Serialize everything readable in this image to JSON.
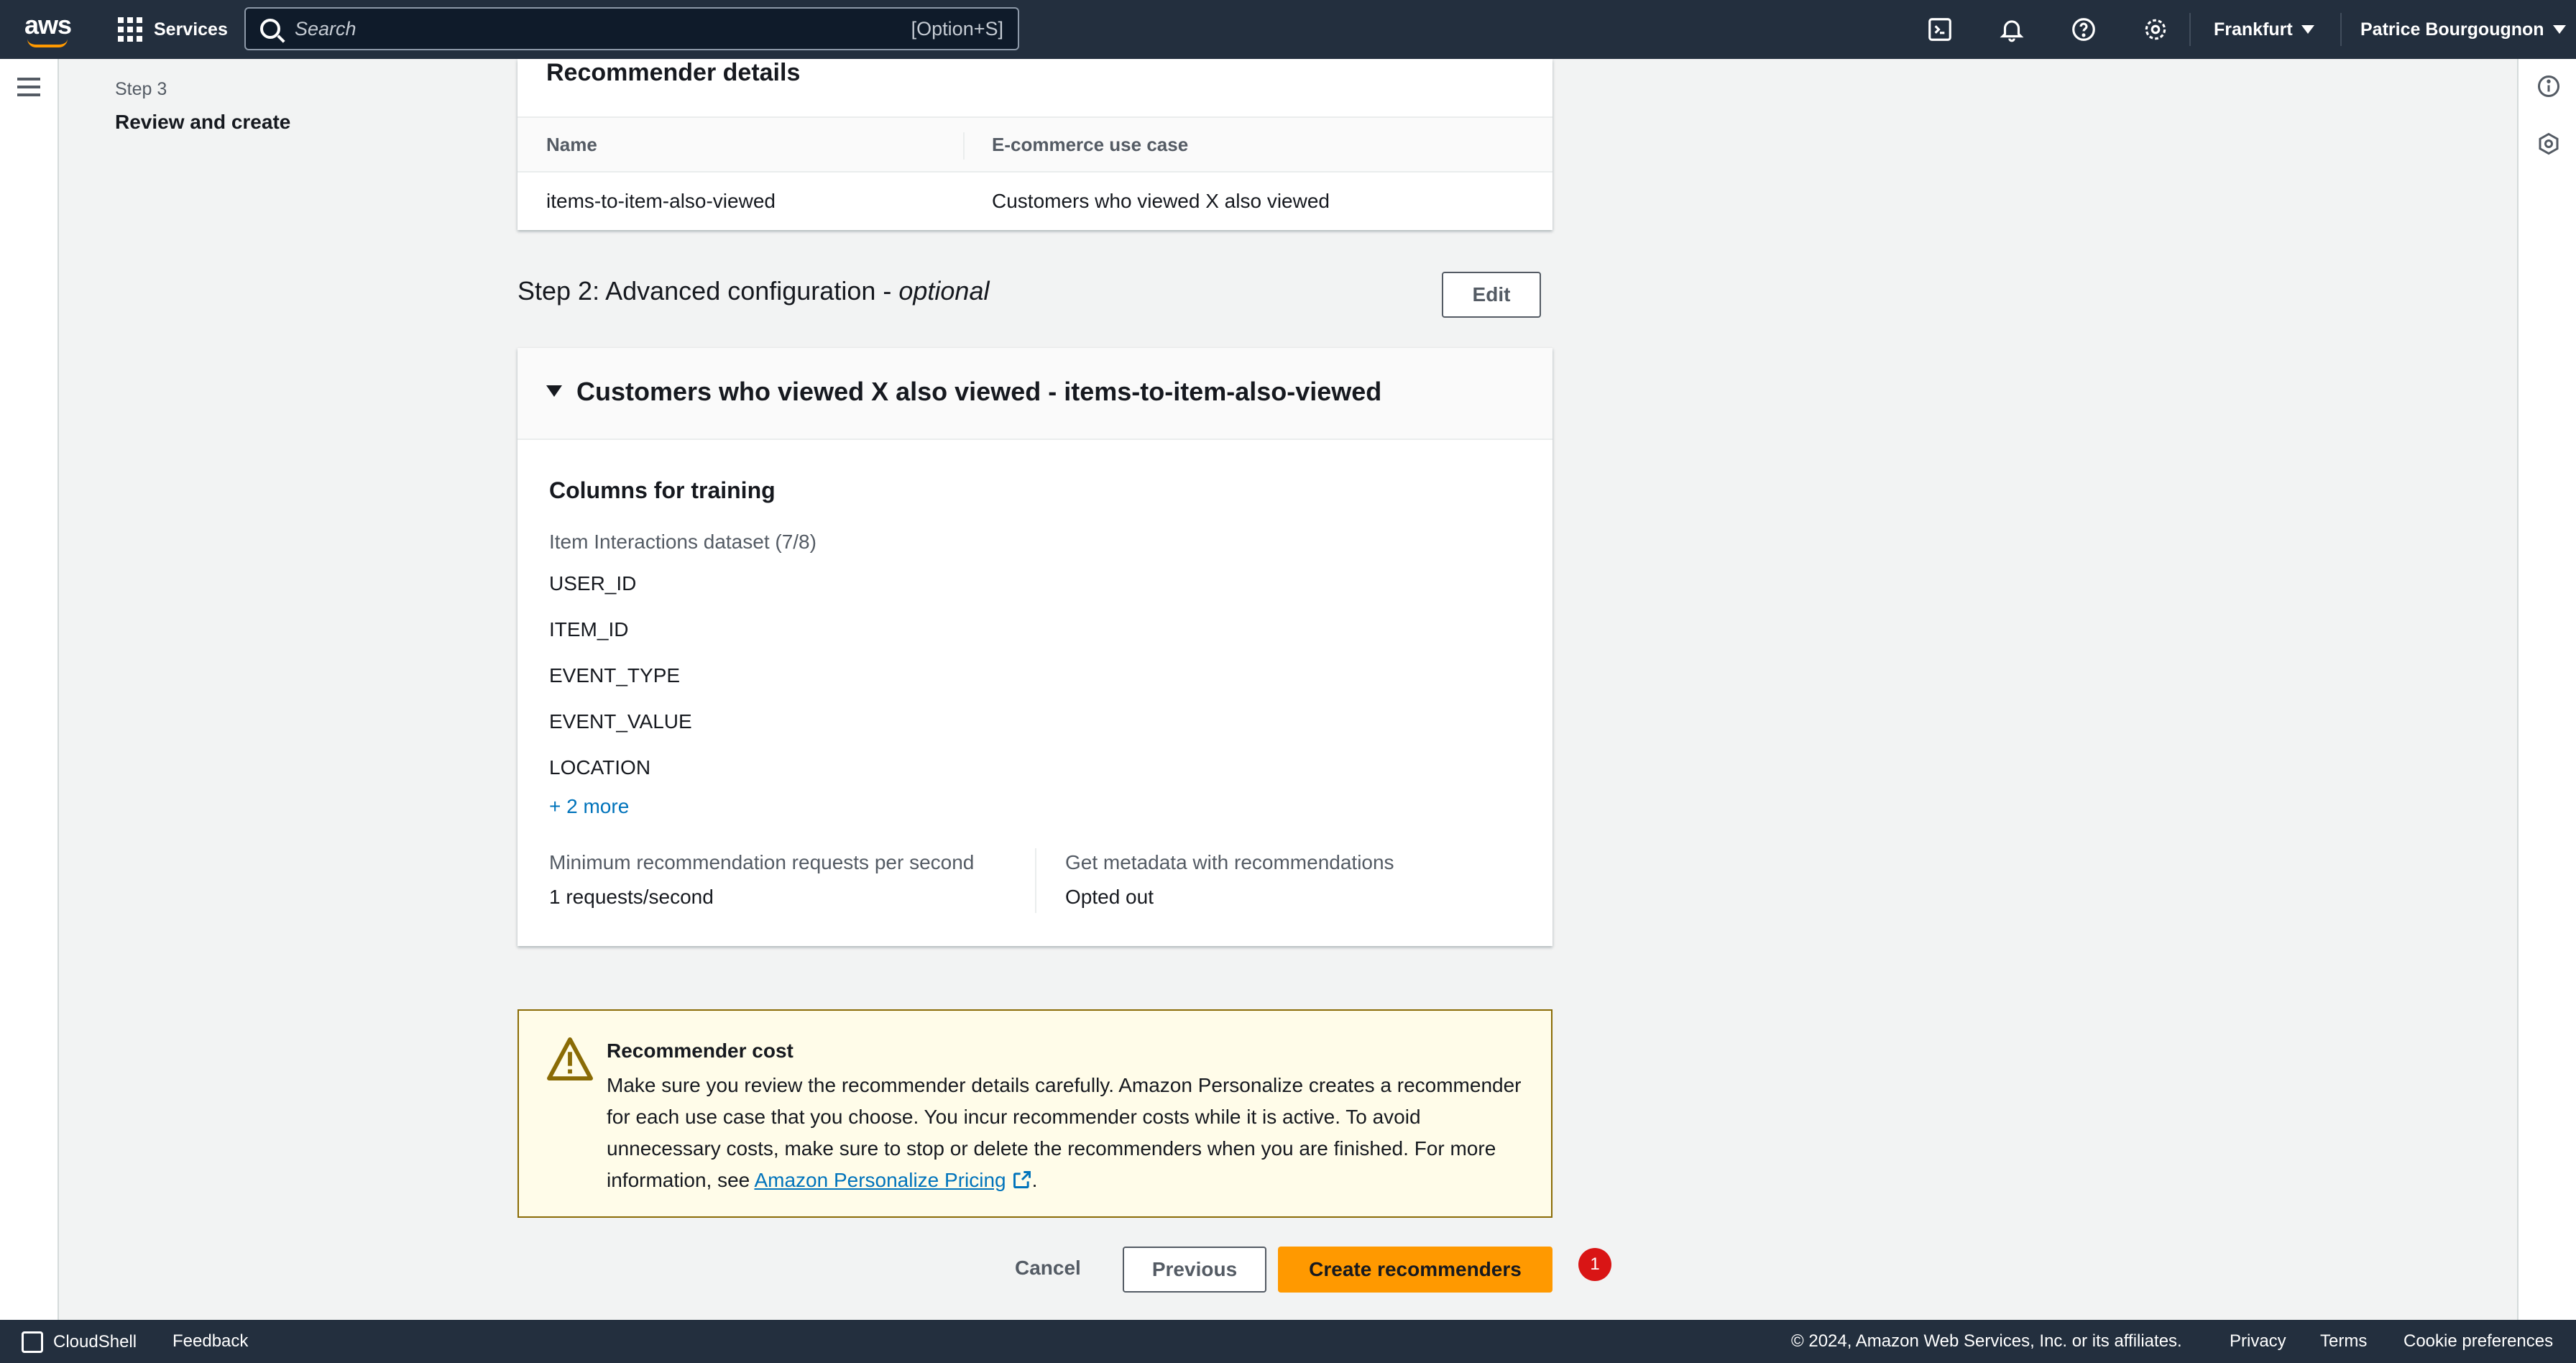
{
  "topbar": {
    "logo_text": "aws",
    "services_label": "Services",
    "search_placeholder": "Search",
    "search_hint": "[Option+S]",
    "region": "Frankfurt",
    "user": "Patrice Bourgougnon"
  },
  "wizard": {
    "step_number": "Step 3",
    "step_title": "Review and create"
  },
  "recommender_details": {
    "header": "Recommender details",
    "columns": [
      "Name",
      "E-commerce use case"
    ],
    "row": [
      "items-to-item-also-viewed",
      "Customers who viewed X also viewed"
    ]
  },
  "step2": {
    "title": "Step 2: Advanced configuration - ",
    "optional": "optional",
    "edit_label": "Edit",
    "expander_title": "Customers who viewed X also viewed - items-to-item-also-viewed",
    "columns_title": "Columns for training",
    "dataset_label": "Item Interactions dataset (7/8)",
    "columns": [
      "USER_ID",
      "ITEM_ID",
      "EVENT_TYPE",
      "EVENT_VALUE",
      "LOCATION"
    ],
    "more_link": "+ 2 more",
    "min_requests_label": "Minimum recommendation requests per second",
    "min_requests_value": "1 requests/second",
    "metadata_label": "Get metadata with recommendations",
    "metadata_value": "Opted out"
  },
  "alert": {
    "title": "Recommender cost",
    "body": "Make sure you review the recommender details carefully. Amazon Personalize creates a recommender for each use case that you choose. You incur recommender costs while it is active. To avoid unnecessary costs, make sure to stop or delete the recommenders when you are finished. For more information, see ",
    "link": "Amazon Personalize Pricing",
    "end": "."
  },
  "actions": {
    "cancel": "Cancel",
    "previous": "Previous",
    "create": "Create recommenders",
    "badge": "1"
  },
  "footer": {
    "cloudshell": "CloudShell",
    "feedback": "Feedback",
    "copyright": "© 2024, Amazon Web Services, Inc. or its affiliates.",
    "privacy": "Privacy",
    "terms": "Terms",
    "cookies": "Cookie preferences"
  },
  "colors": {
    "topbar": "#232f3e",
    "primary": "#ff9900",
    "link": "#0073bb",
    "warning_bg": "#fffce9",
    "badge": "#d91515"
  }
}
